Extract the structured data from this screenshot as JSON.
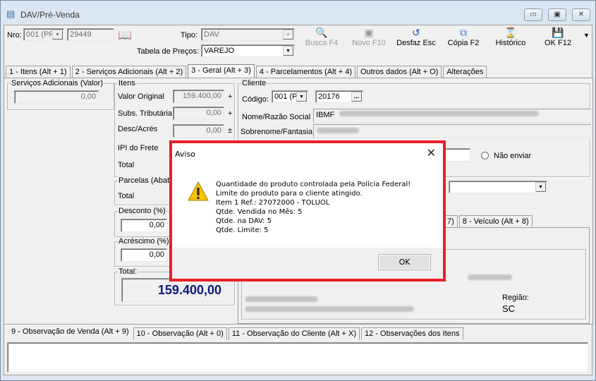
{
  "window": {
    "title": "DAV/Pré-Venda",
    "minimize": "▭",
    "maximize": "▣",
    "close": "✕"
  },
  "header": {
    "nro_label": "Nro:",
    "nro_combo": "001 (PR",
    "nro_value": "29449",
    "tipo_label": "Tipo:",
    "tipo_value": "DAV",
    "tabela_label": "Tabela de Preços:",
    "tabela_value": "VAREJO"
  },
  "toolbar": {
    "busca": "Busca F4",
    "novo": "Novo F10",
    "desfaz": "Desfaz Esc",
    "copia": "Cópia F2",
    "historico": "Histórico",
    "ok": "OK F12",
    "more": "▼"
  },
  "tabs": [
    "1 - Itens (Alt + 1)",
    "2 - Serviços Adicionais (Alt + 2)",
    "3 - Geral (Alt + 3)",
    "4 - Parcelamentos (Alt + 4)",
    "Outros dados (Alt + O)",
    "Alterações"
  ],
  "geral": {
    "servicos_title": "Serviços Adicionais (Valor)",
    "servicos_value": "0,00",
    "itens_title": "Itens",
    "valor_original_label": "Valor Original",
    "valor_original": "159.400,00",
    "plus1": "+",
    "subs_label": "Subs. Tributária",
    "subs_value": "0,00",
    "plus2": "+",
    "desc_label": "Desc/Acrés",
    "desc_value": "0,00",
    "plusminus": "±",
    "ipi_label": "IPI do Frete",
    "total_label": "Total",
    "parcelas_title": "Parcelas (Abati",
    "parcelas_total_label": "Total",
    "desconto_title": "Desconto  (%)",
    "desconto_value": "0,00",
    "acrescimo_title": "Acréscimo  (%)",
    "acrescimo_value": "0,00",
    "total_title": "Total:",
    "total_value": "159.400,00",
    "total_color": "#0a1a7a"
  },
  "cliente": {
    "title": "Cliente",
    "codigo_label": "Código:",
    "codigo_combo": "001 (PI",
    "codigo_value": "20176",
    "lookup": "...",
    "nome_label": "Nome/Razão Social",
    "nome_value": "IBMF",
    "sobrenome_label": "Sobrenome/Fantasia",
    "radio_label": "Não enviar",
    "subtabs": [
      "7)",
      "8 - Veículo (Alt + 8)"
    ],
    "regiao_label": "Região:",
    "regiao_value": "SC"
  },
  "bottom_tabs": [
    "9 - Observação de Venda (Alt + 9)",
    "10 - Observação (Alt + 0)",
    "11 - Observação do Cliente (Alt + X)",
    "12 - Observações dos Itens"
  ],
  "dialog": {
    "title": "Aviso",
    "close": "✕",
    "icon": "warning-icon",
    "lines": [
      "Quantidade do produto controlada pela Polícia Federal!",
      "Limite do produto para o cliente atingido.",
      "Item 1 Ref.: 27072000 - TOLUOL",
      "Qtde. Vendida no Mês: 5",
      "Qtde. na DAV: 5",
      "Qtde. Limite: 5"
    ],
    "ok": "OK",
    "highlight_color": "#e8202a"
  }
}
